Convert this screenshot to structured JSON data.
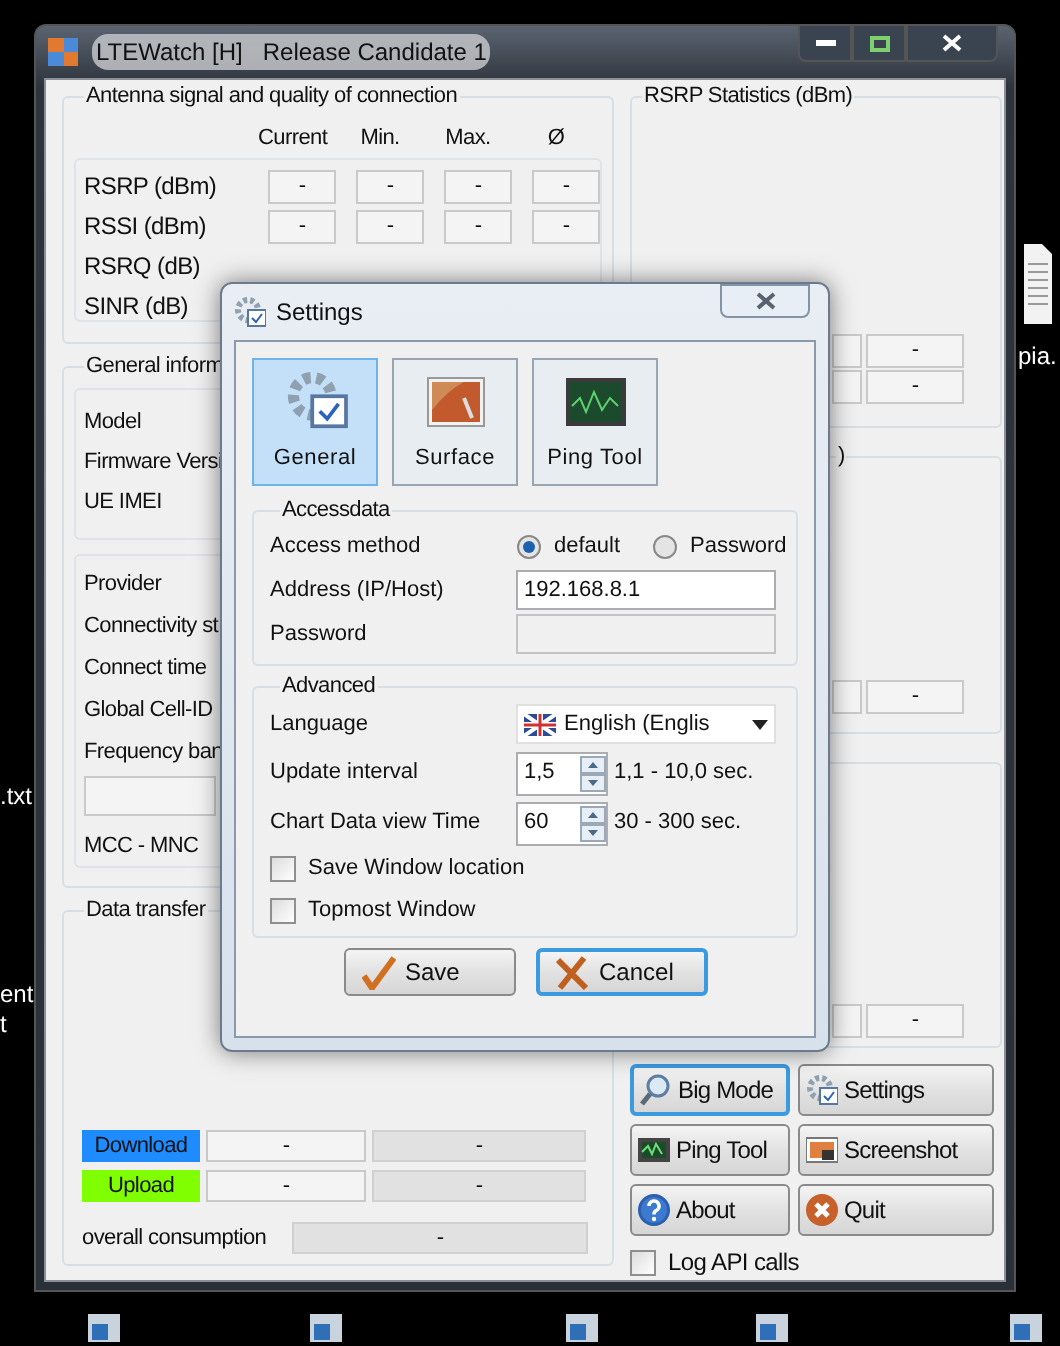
{
  "desktop_labels": [
    {
      "text": "pia."
    },
    {
      "text": ".txt"
    },
    {
      "text": "ent"
    },
    {
      "text": "t"
    }
  ],
  "main_window": {
    "title": "LTEWatch [H]   Release Candidate 1",
    "antenna": {
      "title": "Antenna signal and quality of connection",
      "columns": [
        "Current",
        "Min.",
        "Max.",
        "Ø"
      ],
      "rows": [
        {
          "label": "RSRP (dBm)",
          "values": [
            "-",
            "-",
            "-",
            "-"
          ]
        },
        {
          "label": "RSSI (dBm)",
          "values": [
            "-",
            "-",
            "-",
            "-"
          ]
        },
        {
          "label": "RSRQ (dB)"
        },
        {
          "label": "SINR (dB)"
        }
      ]
    },
    "general_info": {
      "title": "General inform",
      "device_fields": [
        "Model",
        "Firmware Versi",
        "UE IMEI"
      ],
      "network_fields": [
        "Provider",
        "Connectivity st",
        "Connect time",
        "Global Cell-ID",
        "Frequency ban"
      ],
      "mcc_label": "MCC - MNC"
    },
    "data_transfer": {
      "title": "Data transfer",
      "rows": [
        {
          "label": "Download",
          "color": "#1e8cff",
          "values": [
            "-",
            "-"
          ]
        },
        {
          "label": "Upload",
          "color": "#80ff00",
          "values": [
            "-",
            "-"
          ]
        }
      ],
      "overall": {
        "label": "overall consumption",
        "value": "-"
      }
    },
    "rsrp_statistics": {
      "title": "RSRP Statistics (dBm)",
      "values": [
        "-",
        "-"
      ]
    },
    "panel_2": {
      "title": ")",
      "values": [
        "-"
      ]
    },
    "panel_3": {
      "values": [
        "-"
      ]
    },
    "buttons": [
      {
        "label": "Big Mode",
        "focused": true
      },
      {
        "label": "Settings",
        "focused": false
      },
      {
        "label": "Ping Tool",
        "focused": false
      },
      {
        "label": "Screenshot",
        "focused": false
      },
      {
        "label": "About",
        "focused": false
      },
      {
        "label": "Quit",
        "focused": false
      }
    ],
    "log_api_calls": {
      "label": "Log API calls",
      "checked": false
    }
  },
  "settings_dialog": {
    "title": "Settings",
    "tabs": [
      {
        "label": "General",
        "selected": true
      },
      {
        "label": "Surface",
        "selected": false
      },
      {
        "label": "Ping Tool",
        "selected": false
      }
    ],
    "accessdata": {
      "title": "Accessdata",
      "access_method": {
        "label": "Access method",
        "options": [
          {
            "label": "default",
            "selected": true
          },
          {
            "label": "Password",
            "selected": false
          }
        ]
      },
      "address": {
        "label": "Address (IP/Host)",
        "value": "192.168.8.1"
      },
      "password": {
        "label": "Password",
        "disabled": true
      }
    },
    "advanced": {
      "title": "Advanced",
      "language": {
        "label": "Language",
        "value": "English (Englis"
      },
      "update_interval": {
        "label": "Update interval",
        "value": "1,5",
        "range": "1,1 - 10,0 sec."
      },
      "chart_view_time": {
        "label": "Chart Data view Time",
        "value": "60",
        "range": "30 - 300 sec."
      },
      "checkboxes": [
        {
          "label": "Save Window location",
          "checked": false
        },
        {
          "label": "Topmost Window",
          "checked": false
        }
      ]
    },
    "buttons": [
      {
        "label": "Save",
        "kind": "save",
        "focused": false
      },
      {
        "label": "Cancel",
        "kind": "cancel",
        "focused": true
      }
    ]
  }
}
